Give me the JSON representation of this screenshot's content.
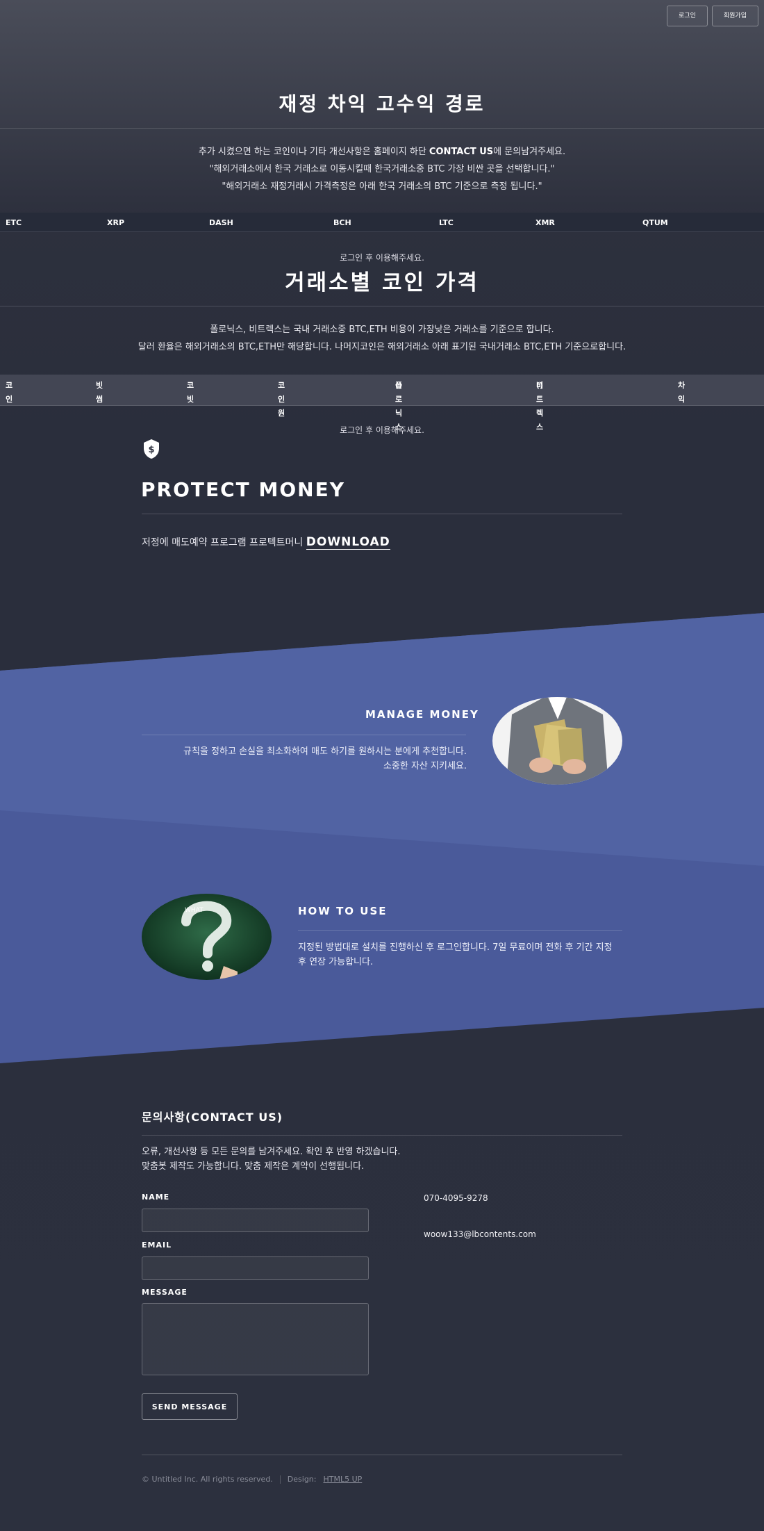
{
  "auth": {
    "login": "로그인",
    "signup": "회원가입"
  },
  "hero": {
    "title": "재정 차익 고수익 경로",
    "line1_pre": "추가 시켰으면 하는 코인이나 기타 개선사항은 홈페이지 하단 ",
    "line1_link": "CONTACT US",
    "line1_post": "에 문의남겨주세요.",
    "line2": "\"해외거래소에서 한국 거래소로 이동시킬때 한국거래소중 BTC 가장 비싼 곳을 선택합니다.\"",
    "line3": "\"해외거래소 재정거래시 가격측정은 아래 한국 거래소의 BTC 기준으로 측정 됩니다.\""
  },
  "ticker": [
    "ETC",
    "XRP",
    "DASH",
    "BCH",
    "LTC",
    "XMR",
    "QTUM"
  ],
  "login_notice": "로그인 후 이용해주세요.",
  "exchange": {
    "title": "거래소별 코인 가격",
    "desc1": "폴로닉스, 비트렉스는 국내 거래소중 BTC,ETH 비용이 가장낮은 거래소를 기준으로 합니다.",
    "desc2": "달러 환율은 해외거래소의 BTC,ETH만 해당합니다. 나머지코인은 해외거래소 아래 표기된 국내거래소 BTC,ETH 기준으로합니다.",
    "columns": [
      {
        "label": "코인",
        "sub": ""
      },
      {
        "label": "빗썸",
        "sub": ""
      },
      {
        "label": "코빗",
        "sub": ""
      },
      {
        "label": "코인원",
        "sub": ""
      },
      {
        "label": "폴로닉스",
        "sub": "()"
      },
      {
        "label": "비트렉스",
        "sub": "()"
      },
      {
        "label": "차익",
        "sub": ""
      }
    ],
    "notice": "로그인 후 이용해주세요."
  },
  "protect": {
    "icon": "shield-dollar-icon",
    "title": "PROTECT MONEY",
    "text": "저정에 매도예약 프로그램 프로텍트머니 ",
    "download": "DOWNLOAD"
  },
  "manage": {
    "title": "MANAGE MONEY",
    "line1": "규칙을 정하고 손실을 최소화하여 매도 하기를 원하시는 분에게 추천합니다.",
    "line2": "소중한 자산 지키세요."
  },
  "howto": {
    "title": "HOW TO USE",
    "line1": "지정된 방법대로 설치를 진행하신 후 로그인합니다. 7일 무료이며 전화 후 기간 지정",
    "line2": "후 연장 가능합니다."
  },
  "contact": {
    "title": "문의사항(CONTACT US)",
    "desc1": "오류, 개선사항 등 모든 문의를 남겨주세요. 확인 후 반영 하겠습니다.",
    "desc2": "맞춤봇 제작도 가능합니다. 맞춤 제작은 계약이 선행됩니다.",
    "name_label": "NAME",
    "email_label": "EMAIL",
    "message_label": "MESSAGE",
    "send": "SEND MESSAGE",
    "phone": "070-4095-9278",
    "email": "woow133@lbcontents.com"
  },
  "footer": {
    "copyright": "© Untitled Inc. All rights reserved.",
    "design_label": "Design:",
    "design_link": "HTML5 UP"
  },
  "colors": {
    "band": "#4a5a9a",
    "band_light": "#5163a3",
    "bg": "#2c303e"
  }
}
